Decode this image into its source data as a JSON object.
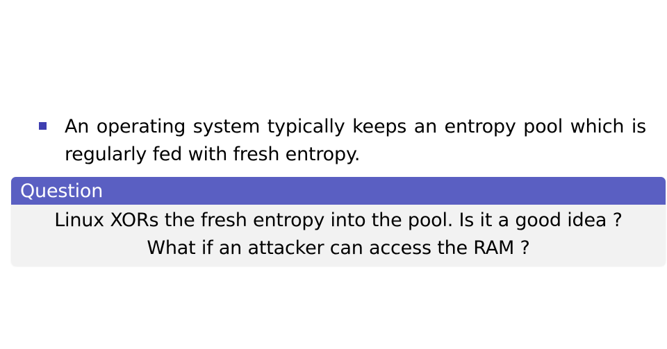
{
  "bullet": {
    "text": "An operating system typically keeps an entropy pool which is regularly fed with fresh entropy."
  },
  "question_block": {
    "title": "Question",
    "line1": "Linux XORs the fresh entropy into the pool. Is it a good idea ?",
    "line2": "What if an attacker can access the RAM ?"
  },
  "colors": {
    "bullet_marker": "#3f3fb0",
    "block_title_bg": "#5a5fc2",
    "block_body_bg": "#f2f2f2"
  }
}
